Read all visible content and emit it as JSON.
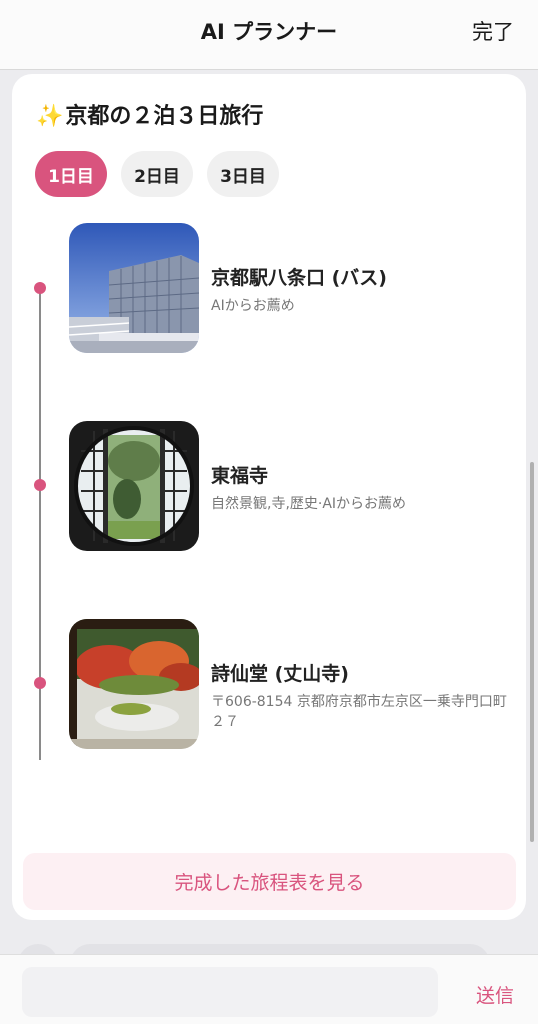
{
  "header": {
    "title": "AI プランナー",
    "done_label": "完了"
  },
  "plan": {
    "sparkle": "✨",
    "title": "京都の２泊３日旅行",
    "tabs": [
      {
        "label": "1日目",
        "active": true
      },
      {
        "label": "2日目",
        "active": false
      },
      {
        "label": "3日目",
        "active": false
      }
    ],
    "spots": [
      {
        "name": "京都駅八条口 (バス)",
        "sub": "AIからお薦め"
      },
      {
        "name": "東福寺",
        "sub": "自然景観,寺,歴史·AIからお薦め"
      },
      {
        "name": "詩仙堂 (丈山寺)",
        "sub": "〒606-8154 京都府京都市左京区一乗寺門口町２７"
      }
    ],
    "view_button": "完成した旅程表を見る"
  },
  "composer": {
    "input_value": "",
    "placeholder": "",
    "send_label": "送信"
  },
  "colors": {
    "accent": "#d9547e",
    "accent_light": "#fdf0f3"
  }
}
